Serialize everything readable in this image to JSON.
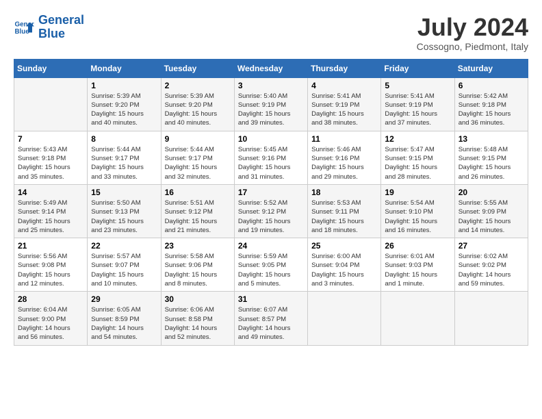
{
  "logo": {
    "line1": "General",
    "line2": "Blue"
  },
  "title": "July 2024",
  "location": "Cossogno, Piedmont, Italy",
  "columns": [
    "Sunday",
    "Monday",
    "Tuesday",
    "Wednesday",
    "Thursday",
    "Friday",
    "Saturday"
  ],
  "weeks": [
    [
      {
        "day": "",
        "info": ""
      },
      {
        "day": "1",
        "info": "Sunrise: 5:39 AM\nSunset: 9:20 PM\nDaylight: 15 hours\nand 40 minutes."
      },
      {
        "day": "2",
        "info": "Sunrise: 5:39 AM\nSunset: 9:20 PM\nDaylight: 15 hours\nand 40 minutes."
      },
      {
        "day": "3",
        "info": "Sunrise: 5:40 AM\nSunset: 9:19 PM\nDaylight: 15 hours\nand 39 minutes."
      },
      {
        "day": "4",
        "info": "Sunrise: 5:41 AM\nSunset: 9:19 PM\nDaylight: 15 hours\nand 38 minutes."
      },
      {
        "day": "5",
        "info": "Sunrise: 5:41 AM\nSunset: 9:19 PM\nDaylight: 15 hours\nand 37 minutes."
      },
      {
        "day": "6",
        "info": "Sunrise: 5:42 AM\nSunset: 9:18 PM\nDaylight: 15 hours\nand 36 minutes."
      }
    ],
    [
      {
        "day": "7",
        "info": "Sunrise: 5:43 AM\nSunset: 9:18 PM\nDaylight: 15 hours\nand 35 minutes."
      },
      {
        "day": "8",
        "info": "Sunrise: 5:44 AM\nSunset: 9:17 PM\nDaylight: 15 hours\nand 33 minutes."
      },
      {
        "day": "9",
        "info": "Sunrise: 5:44 AM\nSunset: 9:17 PM\nDaylight: 15 hours\nand 32 minutes."
      },
      {
        "day": "10",
        "info": "Sunrise: 5:45 AM\nSunset: 9:16 PM\nDaylight: 15 hours\nand 31 minutes."
      },
      {
        "day": "11",
        "info": "Sunrise: 5:46 AM\nSunset: 9:16 PM\nDaylight: 15 hours\nand 29 minutes."
      },
      {
        "day": "12",
        "info": "Sunrise: 5:47 AM\nSunset: 9:15 PM\nDaylight: 15 hours\nand 28 minutes."
      },
      {
        "day": "13",
        "info": "Sunrise: 5:48 AM\nSunset: 9:15 PM\nDaylight: 15 hours\nand 26 minutes."
      }
    ],
    [
      {
        "day": "14",
        "info": "Sunrise: 5:49 AM\nSunset: 9:14 PM\nDaylight: 15 hours\nand 25 minutes."
      },
      {
        "day": "15",
        "info": "Sunrise: 5:50 AM\nSunset: 9:13 PM\nDaylight: 15 hours\nand 23 minutes."
      },
      {
        "day": "16",
        "info": "Sunrise: 5:51 AM\nSunset: 9:12 PM\nDaylight: 15 hours\nand 21 minutes."
      },
      {
        "day": "17",
        "info": "Sunrise: 5:52 AM\nSunset: 9:12 PM\nDaylight: 15 hours\nand 19 minutes."
      },
      {
        "day": "18",
        "info": "Sunrise: 5:53 AM\nSunset: 9:11 PM\nDaylight: 15 hours\nand 18 minutes."
      },
      {
        "day": "19",
        "info": "Sunrise: 5:54 AM\nSunset: 9:10 PM\nDaylight: 15 hours\nand 16 minutes."
      },
      {
        "day": "20",
        "info": "Sunrise: 5:55 AM\nSunset: 9:09 PM\nDaylight: 15 hours\nand 14 minutes."
      }
    ],
    [
      {
        "day": "21",
        "info": "Sunrise: 5:56 AM\nSunset: 9:08 PM\nDaylight: 15 hours\nand 12 minutes."
      },
      {
        "day": "22",
        "info": "Sunrise: 5:57 AM\nSunset: 9:07 PM\nDaylight: 15 hours\nand 10 minutes."
      },
      {
        "day": "23",
        "info": "Sunrise: 5:58 AM\nSunset: 9:06 PM\nDaylight: 15 hours\nand 8 minutes."
      },
      {
        "day": "24",
        "info": "Sunrise: 5:59 AM\nSunset: 9:05 PM\nDaylight: 15 hours\nand 5 minutes."
      },
      {
        "day": "25",
        "info": "Sunrise: 6:00 AM\nSunset: 9:04 PM\nDaylight: 15 hours\nand 3 minutes."
      },
      {
        "day": "26",
        "info": "Sunrise: 6:01 AM\nSunset: 9:03 PM\nDaylight: 15 hours\nand 1 minute."
      },
      {
        "day": "27",
        "info": "Sunrise: 6:02 AM\nSunset: 9:02 PM\nDaylight: 14 hours\nand 59 minutes."
      }
    ],
    [
      {
        "day": "28",
        "info": "Sunrise: 6:04 AM\nSunset: 9:00 PM\nDaylight: 14 hours\nand 56 minutes."
      },
      {
        "day": "29",
        "info": "Sunrise: 6:05 AM\nSunset: 8:59 PM\nDaylight: 14 hours\nand 54 minutes."
      },
      {
        "day": "30",
        "info": "Sunrise: 6:06 AM\nSunset: 8:58 PM\nDaylight: 14 hours\nand 52 minutes."
      },
      {
        "day": "31",
        "info": "Sunrise: 6:07 AM\nSunset: 8:57 PM\nDaylight: 14 hours\nand 49 minutes."
      },
      {
        "day": "",
        "info": ""
      },
      {
        "day": "",
        "info": ""
      },
      {
        "day": "",
        "info": ""
      }
    ]
  ]
}
